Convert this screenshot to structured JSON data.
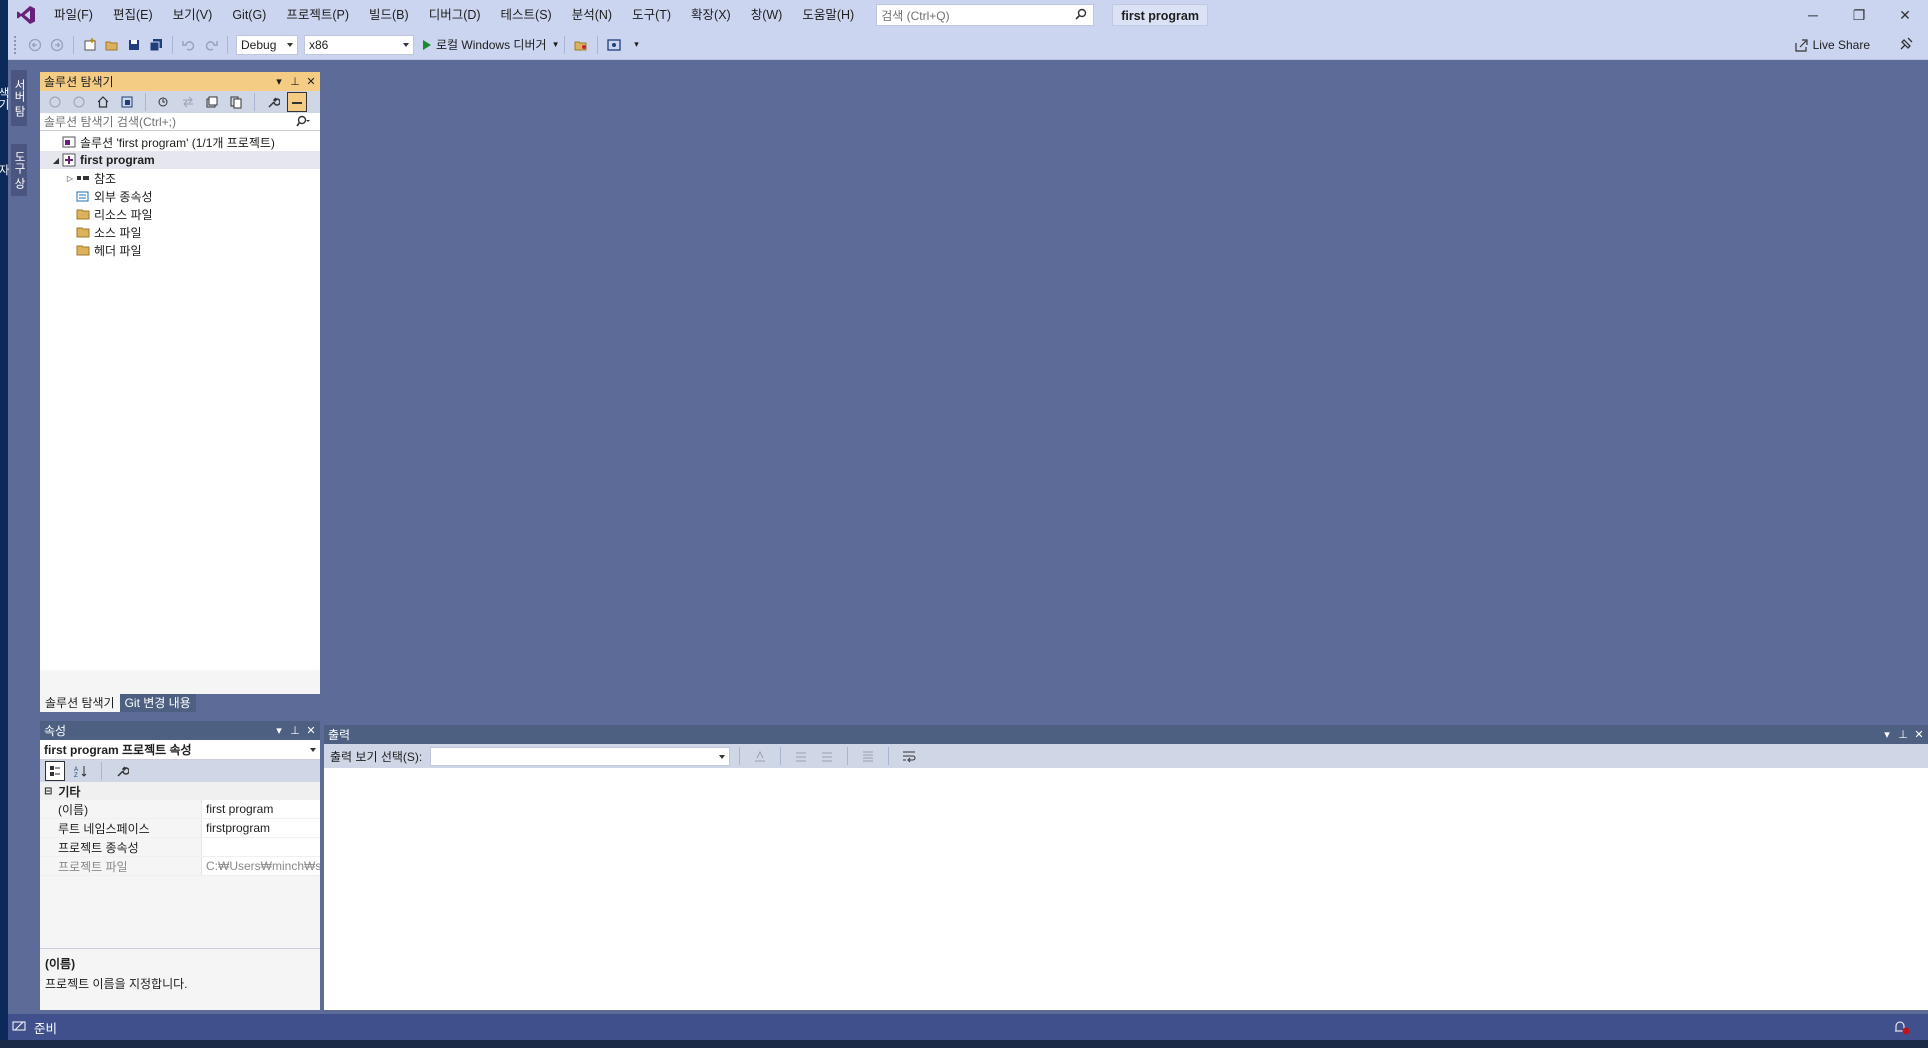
{
  "window": {
    "solution_name": "first program",
    "search_placeholder": "검색 (Ctrl+Q)",
    "minimize": "─",
    "restore": "❐",
    "close": "✕"
  },
  "menu": [
    "파일(F)",
    "편집(E)",
    "보기(V)",
    "Git(G)",
    "프로젝트(P)",
    "빌드(B)",
    "디버그(D)",
    "테스트(S)",
    "분석(N)",
    "도구(T)",
    "확장(X)",
    "창(W)",
    "도움말(H)"
  ],
  "toolbar": {
    "config": "Debug",
    "platform": "x86",
    "run_label": "로컬 Windows 디버거",
    "live_share": "Live Share"
  },
  "vtabs": [
    "서버 탐색기",
    "도구 상자"
  ],
  "solution_explorer": {
    "title": "솔루션 탐색기",
    "search_placeholder": "솔루션 탐색기 검색(Ctrl+;)",
    "tree": [
      {
        "label": "솔루션 'first program' (1/1개 프로젝트)",
        "level": 0,
        "expander": "",
        "bold": false
      },
      {
        "label": "first program",
        "level": 0,
        "expander": "◢",
        "bold": true
      },
      {
        "label": "참조",
        "level": 1,
        "expander": "▷",
        "bold": false
      },
      {
        "label": "외부 종속성",
        "level": 1,
        "expander": "",
        "bold": false
      },
      {
        "label": "리소스 파일",
        "level": 1,
        "expander": "",
        "bold": false
      },
      {
        "label": "소스 파일",
        "level": 1,
        "expander": "",
        "bold": false
      },
      {
        "label": "헤더 파일",
        "level": 1,
        "expander": "",
        "bold": false
      }
    ],
    "tabs": [
      "솔루션 탐색기",
      "Git 변경 내용"
    ]
  },
  "properties": {
    "title": "속성",
    "object": "first program  프로젝트 속성",
    "category": "기타",
    "rows": [
      {
        "name": "(이름)",
        "value": "first program",
        "dim": false
      },
      {
        "name": "루트 네임스페이스",
        "value": "firstprogram",
        "dim": false
      },
      {
        "name": "프로젝트 종속성",
        "value": "",
        "dim": false
      },
      {
        "name": "프로젝트 파일",
        "value": "C:₩Users₩minch₩source₩repos",
        "dim": true
      }
    ],
    "desc_title": "(이름)",
    "desc_text": "프로젝트 이름을 지정합니다."
  },
  "output": {
    "title": "출력",
    "show_label": "출력 보기 선택(S):"
  },
  "status": {
    "text": "준비"
  },
  "colors": {
    "accent_tab": "#f5cc84",
    "vs_purple": "#68217a",
    "status_bg": "#40508d"
  }
}
